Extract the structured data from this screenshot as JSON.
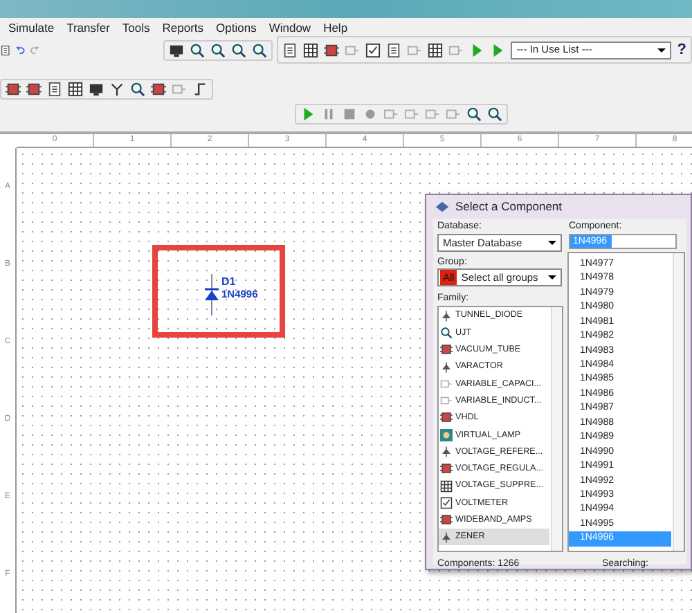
{
  "menu": [
    "Simulate",
    "Transfer",
    "Tools",
    "Reports",
    "Options",
    "Window",
    "Help"
  ],
  "toolbar": {
    "in_use_list": "--- In Use List ---",
    "help": "?"
  },
  "ruler": {
    "columns": [
      "0",
      "1",
      "2",
      "3",
      "4",
      "5",
      "6",
      "7",
      "8"
    ],
    "rows": [
      "A",
      "B",
      "C",
      "D",
      "E",
      "F"
    ]
  },
  "schematic": {
    "reference": "D1",
    "value": "1N4996"
  },
  "dialog": {
    "title": "Select a Component",
    "database_label": "Database:",
    "database_value": "Master Database",
    "group_label": "Group:",
    "group_badge": "All",
    "group_value": "Select all groups",
    "family_label": "Family:",
    "component_label": "Component:",
    "component_value": "1N4996",
    "families": [
      {
        "label": "TUNNEL_DIODE",
        "selected": false
      },
      {
        "label": "UJT",
        "selected": false
      },
      {
        "label": "VACUUM_TUBE",
        "selected": false
      },
      {
        "label": "VARACTOR",
        "selected": false
      },
      {
        "label": "VARIABLE_CAPACI...",
        "selected": false
      },
      {
        "label": "VARIABLE_INDUCT...",
        "selected": false
      },
      {
        "label": "VHDL",
        "selected": false
      },
      {
        "label": "VIRTUAL_LAMP",
        "selected": false
      },
      {
        "label": "VOLTAGE_REFERE...",
        "selected": false
      },
      {
        "label": "VOLTAGE_REGULA...",
        "selected": false
      },
      {
        "label": "VOLTAGE_SUPPRE...",
        "selected": false
      },
      {
        "label": "VOLTMETER",
        "selected": false
      },
      {
        "label": "WIDEBAND_AMPS",
        "selected": false
      },
      {
        "label": "ZENER",
        "selected": true
      }
    ],
    "components": [
      {
        "label": "1N4977",
        "selected": false
      },
      {
        "label": "1N4978",
        "selected": false
      },
      {
        "label": "1N4979",
        "selected": false
      },
      {
        "label": "1N4980",
        "selected": false
      },
      {
        "label": "1N4981",
        "selected": false
      },
      {
        "label": "1N4982",
        "selected": false
      },
      {
        "label": "1N4983",
        "selected": false
      },
      {
        "label": "1N4984",
        "selected": false
      },
      {
        "label": "1N4985",
        "selected": false
      },
      {
        "label": "1N4986",
        "selected": false
      },
      {
        "label": "1N4987",
        "selected": false
      },
      {
        "label": "1N4988",
        "selected": false
      },
      {
        "label": "1N4989",
        "selected": false
      },
      {
        "label": "1N4990",
        "selected": false
      },
      {
        "label": "1N4991",
        "selected": false
      },
      {
        "label": "1N4992",
        "selected": false
      },
      {
        "label": "1N4993",
        "selected": false
      },
      {
        "label": "1N4994",
        "selected": false
      },
      {
        "label": "1N4995",
        "selected": false
      },
      {
        "label": "1N4996",
        "selected": true
      }
    ],
    "count": "Components: 1266",
    "status": "Searching:"
  }
}
